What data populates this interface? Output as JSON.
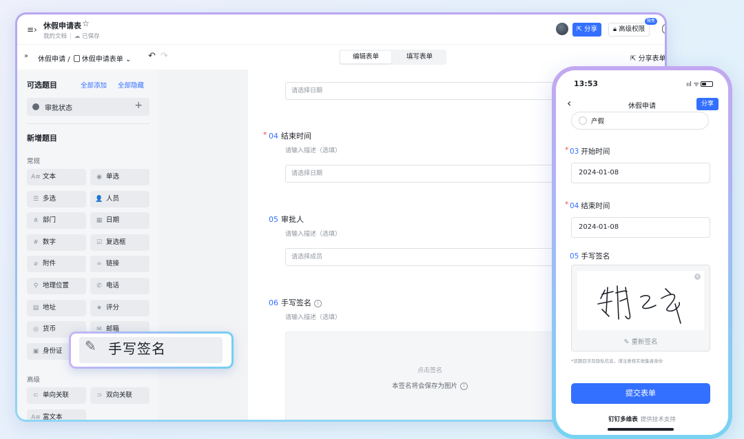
{
  "header": {
    "doc_title": "休假申请表",
    "location": "我的文档",
    "save_status": "已保存",
    "share_label": "分享",
    "permission_label": "高级权限",
    "permission_badge": "限免"
  },
  "toolbar": {
    "breadcrumb_parent": "休假申请",
    "breadcrumb_sep": "/",
    "breadcrumb_current": "休假申请表单",
    "edit_tab": "编辑表单",
    "fill_tab": "填写表单",
    "share_form": "分享表单"
  },
  "sidebar": {
    "optional_title": "可选题目",
    "add_all": "全部添加",
    "hide_all": "全部隐藏",
    "status_item": "审批状态",
    "new_title": "新增题目",
    "group_common": "常规",
    "group_advanced": "高级",
    "fields": [
      {
        "label": "文本",
        "icon": "A≡"
      },
      {
        "label": "单选",
        "icon": "◉"
      },
      {
        "label": "多选",
        "icon": "☰"
      },
      {
        "label": "人员",
        "icon": "👤"
      },
      {
        "label": "部门",
        "icon": "⋔"
      },
      {
        "label": "日期",
        "icon": "▦"
      },
      {
        "label": "数字",
        "icon": "#"
      },
      {
        "label": "复选框",
        "icon": "☑"
      },
      {
        "label": "附件",
        "icon": "⌀"
      },
      {
        "label": "链接",
        "icon": "∞"
      },
      {
        "label": "地理位置",
        "icon": "⚲"
      },
      {
        "label": "电话",
        "icon": "✆"
      },
      {
        "label": "地址",
        "icon": "▤"
      },
      {
        "label": "评分",
        "icon": "★"
      },
      {
        "label": "货币",
        "icon": "◎"
      },
      {
        "label": "邮箱",
        "icon": "✉"
      },
      {
        "label": "身份证",
        "icon": "▣"
      }
    ],
    "advanced_fields": [
      {
        "label": "单向关联",
        "icon": "⊂"
      },
      {
        "label": "双向关联",
        "icon": "⊃"
      },
      {
        "label": "富文本",
        "icon": "A≡"
      }
    ]
  },
  "form": {
    "date_placeholder": "请选择日期",
    "q4": {
      "num": "04",
      "title": "结束时间",
      "desc": "请输入描述（选填）",
      "placeholder": "请选择日期"
    },
    "q5": {
      "num": "05",
      "title": "审批人",
      "desc": "请输入描述（选填）",
      "placeholder": "请选择成员"
    },
    "q6": {
      "num": "06",
      "title": "手写签名",
      "desc": "请输入描述（选填）",
      "sig_hint": "点击签名",
      "sig_note": "本签名将会保存为图片"
    }
  },
  "drag_chip": {
    "label": "手写签名"
  },
  "phone": {
    "time": "13:53",
    "signal": "ııl ᯤ",
    "title": "休假申请",
    "share": "分享",
    "radio_option": "产假",
    "q3": {
      "num": "03",
      "title": "开始时间",
      "value": "2024-01-08"
    },
    "q4": {
      "num": "04",
      "title": "结束时间",
      "value": "2024-01-08"
    },
    "q5": {
      "num": "05",
      "title": "手写签名"
    },
    "resign": "重新签名",
    "privacy": "*该题目涉及隐私信息，请注意核实收集者身份",
    "submit": "提交表单",
    "footer_brand": "钉钉多维表",
    "footer_text": "提供技术支持"
  },
  "colors": {
    "accent": "#3370ff",
    "required": "#f54a45"
  }
}
